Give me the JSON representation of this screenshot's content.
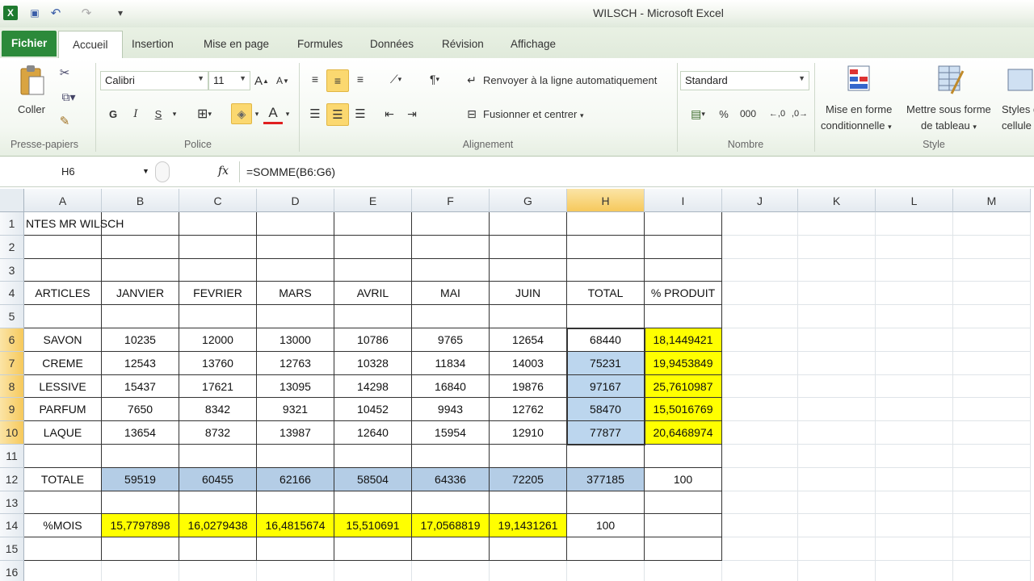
{
  "window": {
    "title": "WILSCH - Microsoft Excel"
  },
  "quick_access": [
    {
      "icon": "excel-logo-icon",
      "glyph": "X"
    },
    {
      "icon": "save-icon",
      "glyph": "▣"
    },
    {
      "icon": "undo-icon",
      "glyph": "↶"
    },
    {
      "icon": "redo-icon",
      "glyph": "↷"
    },
    {
      "icon": "customize-qat-icon",
      "glyph": "▾"
    }
  ],
  "tabs": [
    "Fichier",
    "Accueil",
    "Insertion",
    "Mise en page",
    "Formules",
    "Données",
    "Révision",
    "Affichage"
  ],
  "ribbon": {
    "clipboard": {
      "paste_label": "Coller",
      "group": "Presse-papiers"
    },
    "font": {
      "name": "Calibri",
      "size": "11",
      "bold": "G",
      "italic": "I",
      "underline": "S",
      "group": "Police"
    },
    "alignment": {
      "wrap": "Renvoyer à la ligne automatiquement",
      "merge": "Fusionner et centrer",
      "group": "Alignement"
    },
    "number": {
      "format": "Standard",
      "percent": "%",
      "thousands": "000",
      "group": "Nombre"
    },
    "styles": {
      "conditional": "Mise en forme",
      "conditional2": "conditionnelle",
      "table": "Mettre sous forme",
      "table2": "de tableau",
      "cell": "Styles de",
      "cell2": "cellule",
      "group": "Style"
    }
  },
  "formula_bar": {
    "name_box": "H6",
    "fx": "fx",
    "formula": "=SOMME(B6:G6)"
  },
  "columns": [
    "A",
    "B",
    "C",
    "D",
    "E",
    "F",
    "G",
    "H",
    "I",
    "J",
    "K",
    "L",
    "M"
  ],
  "rows": [
    "1",
    "2",
    "3",
    "4",
    "5",
    "6",
    "7",
    "8",
    "9",
    "10",
    "11",
    "12",
    "13",
    "14",
    "15",
    "16"
  ],
  "sheet": {
    "title": "NTES MR WILSCH",
    "headers": [
      "ARTICLES",
      "JANVIER",
      "FEVRIER",
      "MARS",
      "AVRIL",
      "MAI",
      "JUIN",
      "TOTAL",
      "% PRODUIT"
    ],
    "products": [
      [
        "SAVON",
        "10235",
        "12000",
        "13000",
        "10786",
        "9765",
        "12654",
        "68440",
        "18,1449421"
      ],
      [
        "CREME",
        "12543",
        "13760",
        "12763",
        "10328",
        "11834",
        "14003",
        "75231",
        "19,9453849"
      ],
      [
        "LESSIVE",
        "15437",
        "17621",
        "13095",
        "14298",
        "16840",
        "19876",
        "97167",
        "25,7610987"
      ],
      [
        "PARFUM",
        "7650",
        "8342",
        "9321",
        "10452",
        "9943",
        "12762",
        "58470",
        "15,5016769"
      ],
      [
        "LAQUE",
        "13654",
        "8732",
        "13987",
        "12640",
        "15954",
        "12910",
        "77877",
        "20,6468974"
      ]
    ],
    "total_row": [
      "TOTALE",
      "59519",
      "60455",
      "62166",
      "58504",
      "64336",
      "72205",
      "377185",
      "100"
    ],
    "mois_row": [
      "%MOIS",
      "15,7797898",
      "16,0279438",
      "16,4815674",
      "15,510691",
      "17,0568819",
      "19,1431261",
      "100"
    ]
  }
}
